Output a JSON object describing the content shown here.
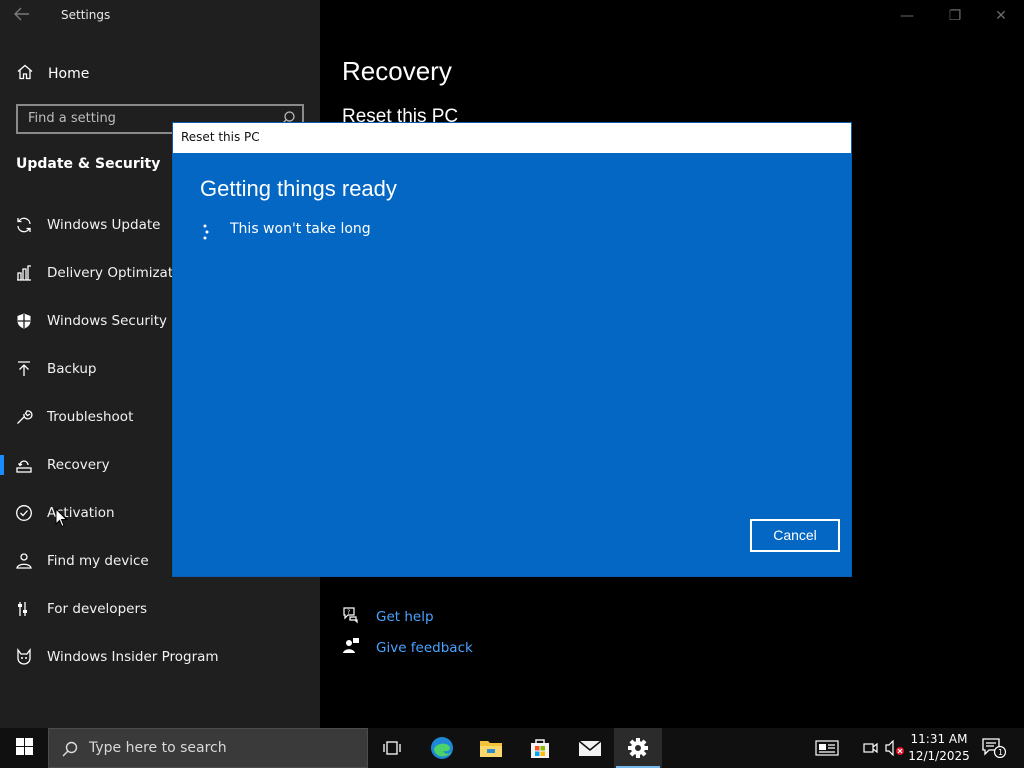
{
  "window": {
    "title": "Settings",
    "controls": [
      "minimize",
      "maximize",
      "close"
    ]
  },
  "sidebar": {
    "home_label": "Home",
    "search_placeholder": "Find a setting",
    "section_title": "Update & Security",
    "items": [
      {
        "label": "Windows Update",
        "icon": "refresh-icon"
      },
      {
        "label": "Delivery Optimization",
        "icon": "delivery-optimization-icon"
      },
      {
        "label": "Windows Security",
        "icon": "shield-icon"
      },
      {
        "label": "Backup",
        "icon": "backup-arrow-icon"
      },
      {
        "label": "Troubleshoot",
        "icon": "wrench-icon"
      },
      {
        "label": "Recovery",
        "icon": "recovery-icon",
        "selected": true
      },
      {
        "label": "Activation",
        "icon": "check-circle-icon"
      },
      {
        "label": "Find my device",
        "icon": "person-location-icon"
      },
      {
        "label": "For developers",
        "icon": "developer-sliders-icon"
      },
      {
        "label": "Windows Insider Program",
        "icon": "insider-cat-icon"
      }
    ]
  },
  "content": {
    "page_title": "Recovery",
    "section_title": "Reset this PC",
    "links": [
      {
        "label": "Get help",
        "icon": "help-chat-icon"
      },
      {
        "label": "Give feedback",
        "icon": "feedback-person-icon"
      }
    ]
  },
  "dialog": {
    "title": "Reset this PC",
    "heading": "Getting things ready",
    "status": "This won't take long",
    "cancel_label": "Cancel"
  },
  "taskbar": {
    "search_placeholder": "Type here to search",
    "apps": [
      "task-view-icon",
      "edge-icon",
      "file-explorer-icon",
      "store-icon",
      "mail-icon",
      "settings-gear-icon"
    ],
    "active_app": "settings-gear-icon",
    "time": "11:31 AM",
    "date": "12/1/2025",
    "notification_count": "1"
  },
  "colors": {
    "dialog_blue": "#0467c4",
    "accent": "#1a8cff",
    "link": "#4aa3ff",
    "sidebar_bg": "#1f1f1f",
    "taskbar_bg": "#101010"
  }
}
